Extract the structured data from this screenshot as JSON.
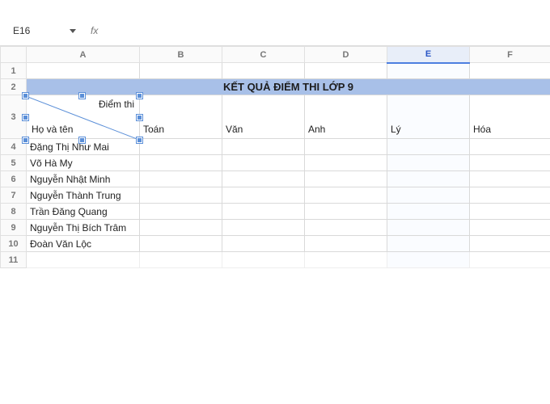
{
  "nameBox": {
    "value": "E16"
  },
  "formulaBar": {
    "fxLabel": "fx",
    "value": ""
  },
  "columns": [
    "A",
    "B",
    "C",
    "D",
    "E",
    "F"
  ],
  "rows": [
    "1",
    "2",
    "3",
    "4",
    "5",
    "6",
    "7",
    "8",
    "9",
    "10",
    "11"
  ],
  "selectedColumn": "E",
  "header": {
    "title": "KẾT QUẢ ĐIỂM THI LỚP 9",
    "diagTop": "Điểm thi",
    "diagBottom": "Họ và tên",
    "subjects": [
      "Toán",
      "Văn",
      "Anh",
      "Lý",
      "Hóa"
    ]
  },
  "students": [
    "Đặng Thị Như Mai",
    "Võ Hà My",
    "Nguyễn Nhật Minh",
    "Nguyễn Thành Trung",
    "Trần Đăng Quang",
    "Nguyễn Thị Bích Trâm",
    "Đoàn Văn Lộc"
  ],
  "colWidths": {
    "rowhead": 32,
    "A": 140,
    "B": 102,
    "C": 102,
    "D": 102,
    "E": 102,
    "F": 100
  },
  "rowHeights": {
    "colhead": 20,
    "1": 20,
    "2": 22,
    "3": 54,
    "data": 20
  }
}
